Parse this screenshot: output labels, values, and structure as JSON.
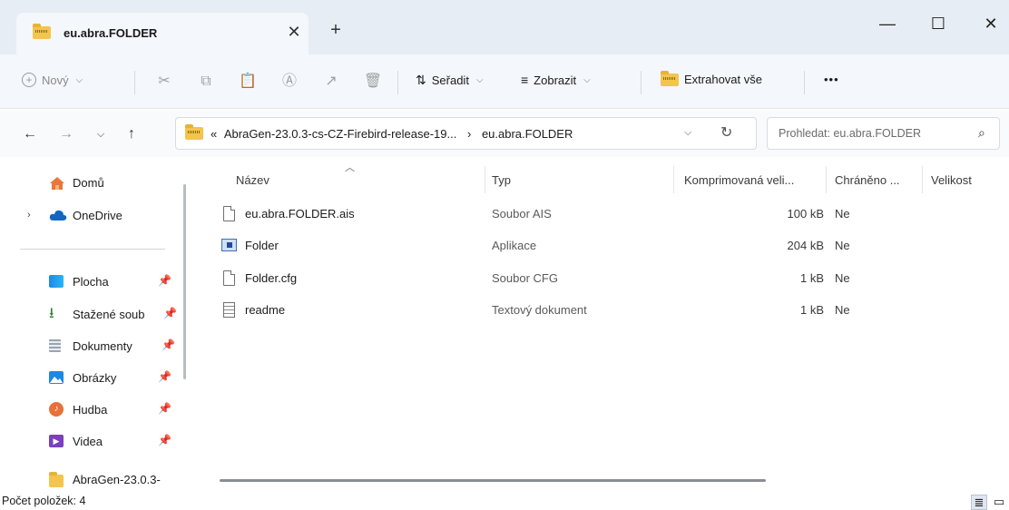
{
  "window": {
    "tab_title": "eu.abra.FOLDER",
    "tab_close": "✕",
    "new_tab": "+",
    "minimize": "—",
    "maximize": "☐",
    "close": "✕"
  },
  "toolbar": {
    "new_label": "Nový",
    "sort_label": "Seřadit",
    "view_label": "Zobrazit",
    "extract_label": "Extrahovat vše",
    "more_label": "•••"
  },
  "address": {
    "path_prefix": "«",
    "path_parent": "AbraGen-23.0.3-cs-CZ-Firebird-release-19...",
    "path_sep": "›",
    "path_current": "eu.abra.FOLDER",
    "search_placeholder": "Prohledat: eu.abra.FOLDER"
  },
  "sidebar": {
    "items": [
      {
        "label": "Domů"
      },
      {
        "label": "OneDrive"
      },
      {
        "label": "Plocha"
      },
      {
        "label": "Stažené soub"
      },
      {
        "label": "Dokumenty"
      },
      {
        "label": "Obrázky"
      },
      {
        "label": "Hudba"
      },
      {
        "label": "Videa"
      },
      {
        "label": "AbraGen-23.0.3-"
      }
    ]
  },
  "columns": {
    "name": "Název",
    "type": "Typ",
    "compressed": "Komprimovaná veli...",
    "protected": "Chráněno ...",
    "size": "Velikost"
  },
  "files": [
    {
      "name": "eu.abra.FOLDER.ais",
      "type": "Soubor AIS",
      "compressed": "100 kB",
      "protected": "Ne",
      "icon": "generic-file-icon"
    },
    {
      "name": "Folder",
      "type": "Aplikace",
      "compressed": "204 kB",
      "protected": "Ne",
      "icon": "application-icon"
    },
    {
      "name": "Folder.cfg",
      "type": "Soubor CFG",
      "compressed": "1 kB",
      "protected": "Ne",
      "icon": "generic-file-icon"
    },
    {
      "name": "readme",
      "type": "Textový dokument",
      "compressed": "1 kB",
      "protected": "Ne",
      "icon": "text-document-icon"
    }
  ],
  "status": {
    "item_count": "Počet položek: 4"
  },
  "colors": {
    "titlebar_bg": "#e7edf4",
    "toolbar_bg": "#f4f7fb",
    "folder_yellow": "#f3c54c"
  }
}
